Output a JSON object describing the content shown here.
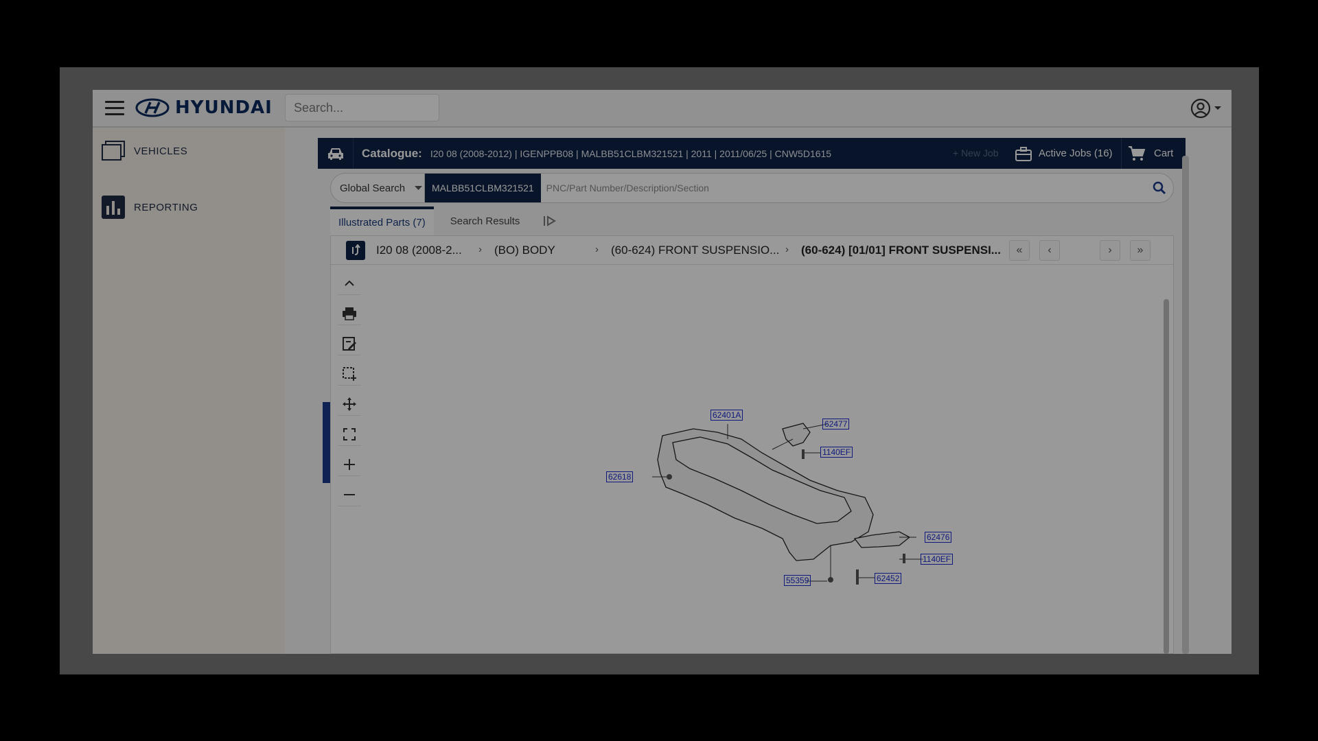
{
  "header": {
    "brand": "HYUNDAI",
    "search_placeholder": "Search..."
  },
  "sidebar": {
    "items": [
      {
        "label": "VEHICLES",
        "icon": "vehicles-icon"
      },
      {
        "label": "REPORTING",
        "icon": "reporting-icon"
      }
    ]
  },
  "catalogue": {
    "label": "Catalogue:",
    "info": "I20 08 (2008-2012)  | IGENPPB08  | MALBB51CLBM321521  | 2011  | 2011/06/25  | CNW5D1615",
    "new_job": "+ New Job",
    "active_jobs": "Active Jobs (16)",
    "cart": "Cart"
  },
  "global_search": {
    "mode": "Global Search",
    "vin": "MALBB51CLBM321521",
    "placeholder": "PNC/Part Number/Description/Section"
  },
  "tabs": [
    {
      "label": "Illustrated Parts (7)",
      "active": true
    },
    {
      "label": "Search Results",
      "active": false
    }
  ],
  "breadcrumbs": [
    "I20 08 (2008-2...",
    "(BO) BODY",
    "(60-624) FRONT SUSPENSIO...",
    "(60-624) [01/01] FRONT SUSPENSI..."
  ],
  "toolbar": [
    "collapse-up-icon",
    "print-icon",
    "edit-note-icon",
    "select-area-icon",
    "move-icon",
    "fullscreen-icon",
    "zoom-in-icon",
    "zoom-out-icon"
  ],
  "callouts": [
    "62401A",
    "62477",
    "1140EF",
    "62618",
    "62476",
    "1140EF",
    "55359",
    "62452"
  ],
  "colors": {
    "navy": "#0d2245",
    "callout_blue": "#1a2bd0"
  }
}
